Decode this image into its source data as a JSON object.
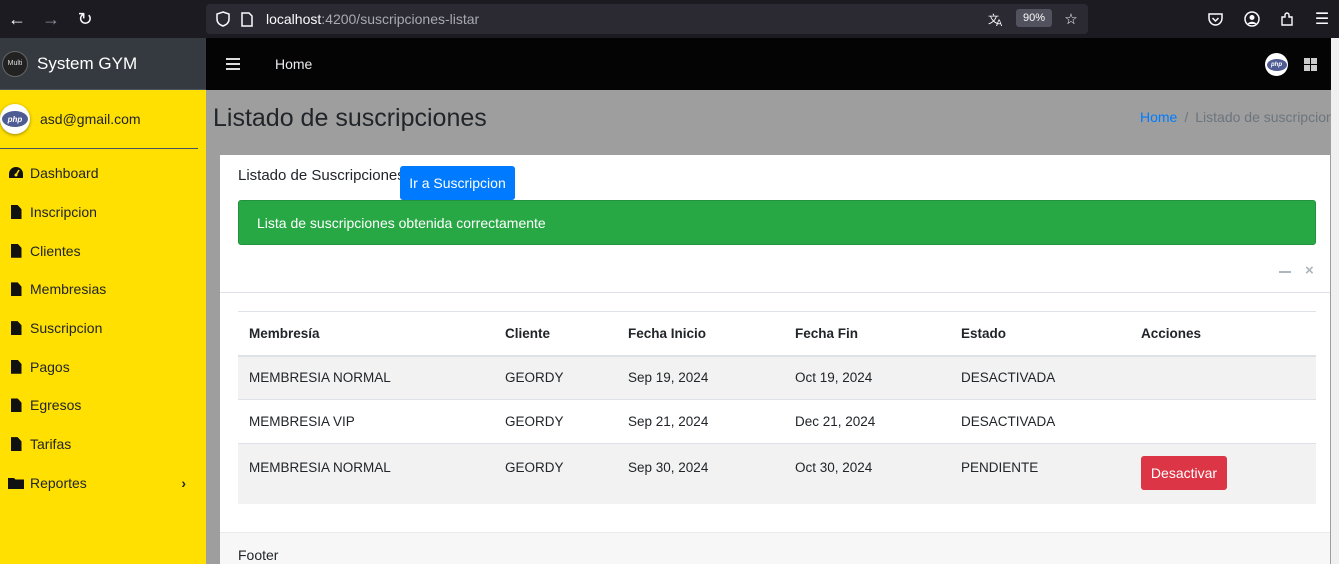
{
  "browser": {
    "url_host": "localhost",
    "url_path": ":4200/suscripciones-listar",
    "zoom": "90%"
  },
  "sidebar": {
    "brand_logo_text": "Multi",
    "brand": "System GYM",
    "user_email": "asd@gmail.com",
    "avatar_text": "php",
    "items": [
      {
        "label": "Dashboard",
        "icon": "dashboard-icon"
      },
      {
        "label": "Inscripcion",
        "icon": "file-icon"
      },
      {
        "label": "Clientes",
        "icon": "file-icon"
      },
      {
        "label": "Membresias",
        "icon": "file-icon"
      },
      {
        "label": "Suscripcion",
        "icon": "file-icon"
      },
      {
        "label": "Pagos",
        "icon": "file-icon"
      },
      {
        "label": "Egresos",
        "icon": "file-icon"
      },
      {
        "label": "Tarifas",
        "icon": "file-icon"
      },
      {
        "label": "Reportes",
        "icon": "folder-icon"
      }
    ]
  },
  "topnav": {
    "home": "Home",
    "avatar_text": "php"
  },
  "header": {
    "title": "Listado de suscripciones",
    "breadcrumb_home": "Home",
    "breadcrumb_sep": "/",
    "breadcrumb_current": "Listado de suscripciones"
  },
  "card": {
    "title": "Listado de Suscripciones",
    "button": "Ir a Suscripcion",
    "alert": "Lista de suscripciones obtenida correctamente",
    "footer": "Footer"
  },
  "table": {
    "columns": [
      "Membresía",
      "Cliente",
      "Fecha Inicio",
      "Fecha Fin",
      "Estado",
      "Acciones"
    ],
    "rows": [
      {
        "membresia": "MEMBRESIA NORMAL",
        "cliente": "GEORDY",
        "inicio": "Sep 19, 2024",
        "fin": "Oct 19, 2024",
        "estado": "DESACTIVADA",
        "accion": ""
      },
      {
        "membresia": "MEMBRESIA VIP",
        "cliente": "GEORDY",
        "inicio": "Sep 21, 2024",
        "fin": "Dec 21, 2024",
        "estado": "DESACTIVADA",
        "accion": ""
      },
      {
        "membresia": "MEMBRESIA NORMAL",
        "cliente": "GEORDY",
        "inicio": "Sep 30, 2024",
        "fin": "Oct 30, 2024",
        "estado": "PENDIENTE",
        "accion": "Desactivar"
      }
    ]
  },
  "colors": {
    "sidebar_bg": "#ffe000",
    "primary": "#007bff",
    "success": "#28a745",
    "danger": "#dc3545"
  }
}
